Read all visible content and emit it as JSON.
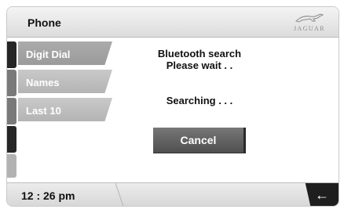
{
  "header": {
    "title": "Phone",
    "brand": "JAGUAR"
  },
  "menu": {
    "items": [
      {
        "label": "Digit Dial",
        "active": true
      },
      {
        "label": "Names",
        "active": false
      },
      {
        "label": "Last 10",
        "active": false
      }
    ]
  },
  "content": {
    "line1": "Bluetooth search",
    "line2": "Please wait . .",
    "status": "Searching . . .",
    "cancel_label": "Cancel"
  },
  "footer": {
    "time": "12 : 26 pm",
    "back_glyph": "←"
  }
}
